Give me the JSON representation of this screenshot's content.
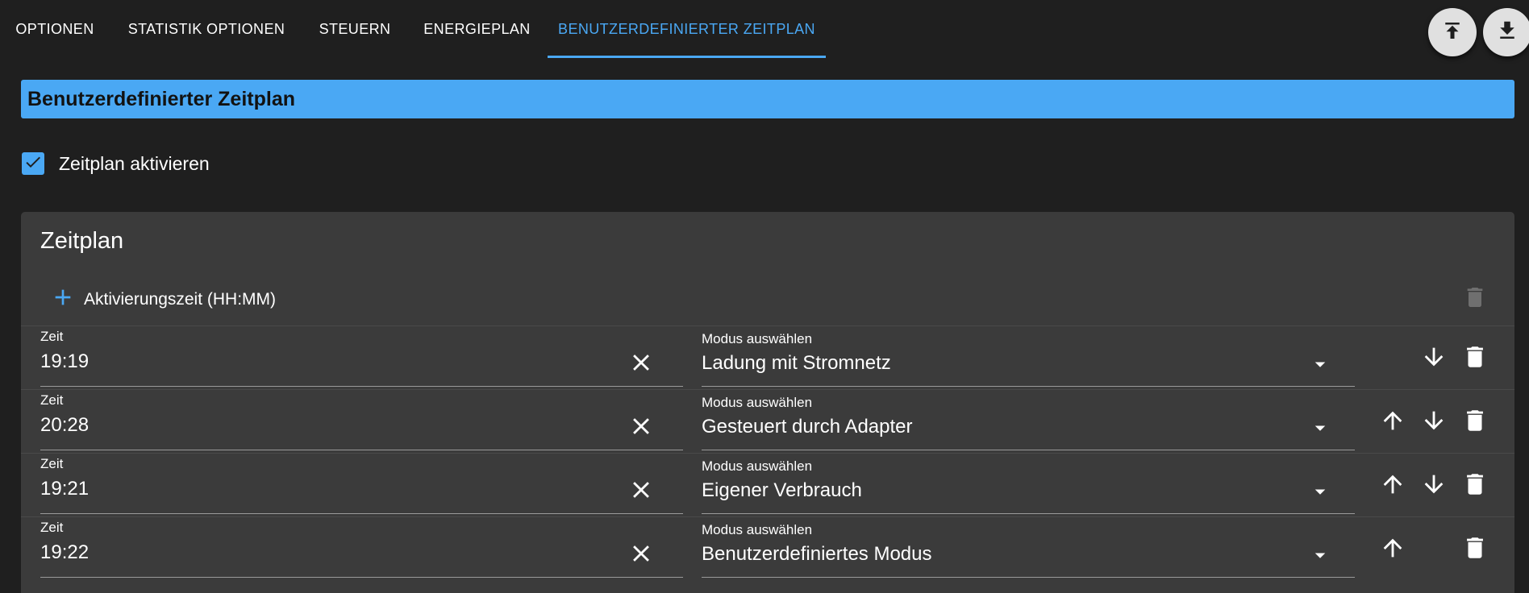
{
  "tabs": [
    {
      "label": "OPTIONEN",
      "active": false
    },
    {
      "label": "STATISTIK OPTIONEN",
      "active": false
    },
    {
      "label": "STEUERN",
      "active": false
    },
    {
      "label": "ENERGIEPLAN",
      "active": false
    },
    {
      "label": "BENUTZERDEFINIERTER ZEITPLAN",
      "active": true
    }
  ],
  "toolbar": {
    "upload_icon": "upload-to-top-icon",
    "download_icon": "download-icon"
  },
  "header": {
    "title": "Benutzerdefinierter Zeitplan"
  },
  "enable_schedule": {
    "label": "Zeitplan aktivieren",
    "checked": true
  },
  "schedule": {
    "title": "Zeitplan",
    "add_label": "Aktivierungszeit (HH:MM)",
    "rows": [
      {
        "time_label": "Zeit",
        "time": "19:19",
        "mode_label": "Modus auswählen",
        "mode": "Ladung mit Stromnetz",
        "can_up": false,
        "can_down": true
      },
      {
        "time_label": "Zeit",
        "time": "20:28",
        "mode_label": "Modus auswählen",
        "mode": "Gesteuert durch Adapter",
        "can_up": true,
        "can_down": true
      },
      {
        "time_label": "Zeit",
        "time": "19:21",
        "mode_label": "Modus auswählen",
        "mode": "Eigener Verbrauch",
        "can_up": true,
        "can_down": true
      },
      {
        "time_label": "Zeit",
        "time": "19:22",
        "mode_label": "Modus auswählen",
        "mode": "Benutzerdefiniertes Modus",
        "can_up": true,
        "can_down": false
      }
    ]
  },
  "colors": {
    "accent": "#4aa8f4",
    "background": "#1f1f1f",
    "panel": "#3b3b3b"
  }
}
